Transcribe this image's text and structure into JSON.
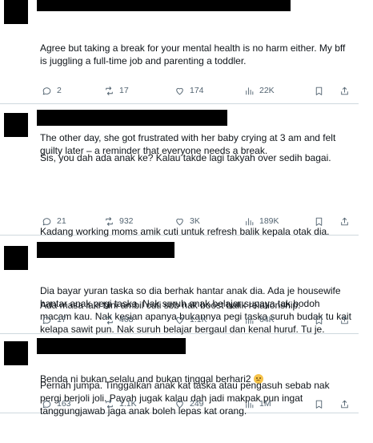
{
  "tweets": [
    {
      "paragraphs": [
        "Agree but taking a break for your mental health is no harm either. My bff is juggling a full-time job and parenting a toddler.",
        "The other day, she got frustrated with her baby crying at 3 am and felt guilty later – a reminder that everyone needs a break."
      ],
      "replies": "2",
      "reposts": "17",
      "likes": "174",
      "views": "22K"
    },
    {
      "paragraphs": [
        "Sis, you dah ada anak ke? Kalau takde lagi takyah over sedih bagai.",
        "Kadang working moms amik cuti untuk refresh balik kepala otak dia.",
        "Ada masa laki bini ambil cuti sbb nak boost balik relationship.",
        "Benda ni bukan selalu and bukan tinggal berhari2"
      ],
      "emoji": "grimacing-face-emoji",
      "replies": "21",
      "reposts": "932",
      "likes": "3K",
      "views": "189K"
    },
    {
      "paragraphs": [
        "Dia bayar yuran taska so dia berhak hantar anak dia. Ada je housewife hantar anak pegi taska. Nak suruh anak belajar supaya tak bodoh macam kau. Nak kesian apanya bukannya pegi taska suruh budak tu kait kelapa sawit pun. Nak suruh belajar bergaul dan kenal huruf. Tu je."
      ],
      "replies": "17",
      "reposts": "408",
      "likes": "1.1K",
      "views": "64K"
    },
    {
      "paragraphs": [
        "Pernah jumpa. Tinggalkan anak kat taska atau pengasuh sebab nak pergi berjoli joli. Payah jugak kalau dah jadi makpak pun ingat tanggungjawab jaga anak boleh lepas kat orang."
      ],
      "replies": "163",
      "reposts": "1.1K",
      "likes": "249",
      "views": "1M"
    }
  ],
  "icons": {
    "reply": "reply-icon",
    "repost": "repost-icon",
    "like": "heart-icon",
    "views": "views-icon",
    "bookmark": "bookmark-icon",
    "share": "share-icon"
  }
}
